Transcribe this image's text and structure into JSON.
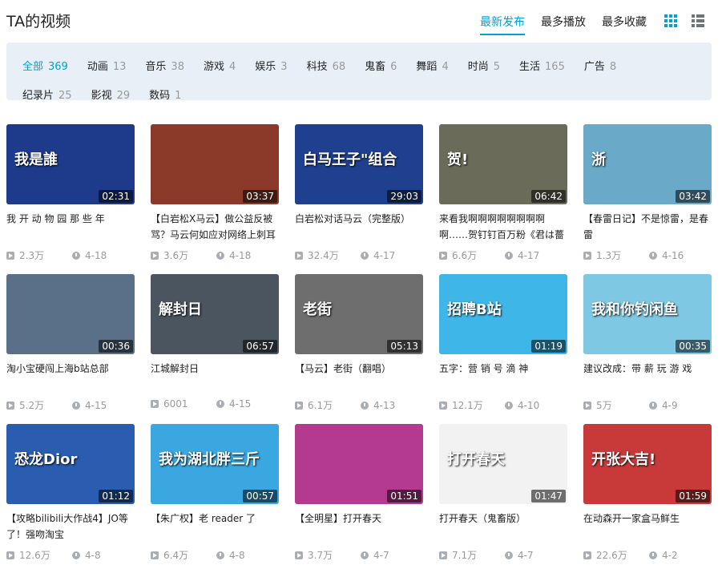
{
  "header": {
    "title": "TA的视频",
    "sort_tabs": [
      "最新发布",
      "最多播放",
      "最多收藏"
    ],
    "active_sort": 0,
    "accent_color": "#00a1d6",
    "grid_view_icon": "grid-icon",
    "list_view_icon": "list-icon"
  },
  "categories": [
    {
      "label": "全部",
      "count": "369"
    },
    {
      "label": "动画",
      "count": "13"
    },
    {
      "label": "音乐",
      "count": "38"
    },
    {
      "label": "游戏",
      "count": "4"
    },
    {
      "label": "娱乐",
      "count": "3"
    },
    {
      "label": "科技",
      "count": "68"
    },
    {
      "label": "鬼畜",
      "count": "6"
    },
    {
      "label": "舞蹈",
      "count": "4"
    },
    {
      "label": "时尚",
      "count": "5"
    },
    {
      "label": "生活",
      "count": "165"
    },
    {
      "label": "广告",
      "count": "8"
    },
    {
      "label": "纪录片",
      "count": "25"
    },
    {
      "label": "影视",
      "count": "29"
    },
    {
      "label": "数码",
      "count": "1"
    }
  ],
  "videos": [
    {
      "title": "我 开 动 物 园 那 些 年",
      "duration": "02:31",
      "views": "2.3万",
      "date": "4-18",
      "thumb_text": "我是誰",
      "thumb_bg": "#1e3a8a"
    },
    {
      "title": "【白岩松X马云】做公益反被骂？马云何如应对网络上刺耳",
      "duration": "03:37",
      "views": "3.6万",
      "date": "4-18",
      "thumb_text": "",
      "thumb_bg": "#8b3a2a"
    },
    {
      "title": "白岩松对话马云（完整版）",
      "duration": "29:03",
      "views": "32.4万",
      "date": "4-17",
      "thumb_text": "白马王子\"组合",
      "thumb_bg": "#1f3f8f"
    },
    {
      "title": "来看我啊啊啊啊啊啊啊啊啊……贺钉钉百万粉《君は薔",
      "duration": "06:42",
      "views": "6.6万",
      "date": "4-17",
      "thumb_text": "贺!",
      "thumb_bg": "#6b6b5a"
    },
    {
      "title": "【春雷日记】不是惊雷，是春雷",
      "duration": "03:42",
      "views": "1.3万",
      "date": "4-16",
      "thumb_text": "浙",
      "thumb_bg": "#6aa9c7"
    },
    {
      "title": "淘小宝硬闯上海b站总部",
      "duration": "00:36",
      "views": "5.2万",
      "date": "4-15",
      "thumb_text": "",
      "thumb_bg": "#5a6f88"
    },
    {
      "title": "江城解封日",
      "duration": "06:57",
      "views": "6001",
      "date": "4-15",
      "thumb_text": "解封日",
      "thumb_bg": "#4a5560"
    },
    {
      "title": "【马云】老街（翻唱）",
      "duration": "05:13",
      "views": "6.1万",
      "date": "4-13",
      "thumb_text": "老街",
      "thumb_bg": "#6e6e6e"
    },
    {
      "title": "五字：营 销 号 滴 神",
      "duration": "01:19",
      "views": "12.1万",
      "date": "4-10",
      "thumb_text": "招聘B站",
      "thumb_bg": "#3fb6e8"
    },
    {
      "title": "建议改成：带 薪 玩 游 戏",
      "duration": "00:35",
      "views": "5万",
      "date": "4-9",
      "thumb_text": "我和你钓闲鱼",
      "thumb_bg": "#7ec8e3"
    },
    {
      "title": "【攻略bilibili大作战4】JO等了！强吻淘宝",
      "duration": "01:12",
      "views": "12.6万",
      "date": "4-8",
      "thumb_text": "恐龙Dior",
      "thumb_bg": "#2a5db0"
    },
    {
      "title": "【朱广权】老 reader 了",
      "duration": "00:57",
      "views": "6.4万",
      "date": "4-8",
      "thumb_text": "我为湖北胖三斤",
      "thumb_bg": "#3aa7e0"
    },
    {
      "title": "【全明星】打开春天",
      "duration": "01:51",
      "views": "3.7万",
      "date": "4-7",
      "thumb_text": "",
      "thumb_bg": "#b43a8f"
    },
    {
      "title": "打开春天（鬼畜版）",
      "duration": "01:47",
      "views": "7.1万",
      "date": "4-7",
      "thumb_text": "打开春天",
      "thumb_bg": "#f2f2f2"
    },
    {
      "title": "在动森开一家盒马鲜生",
      "duration": "01:59",
      "views": "22.6万",
      "date": "4-2",
      "thumb_text": "开张大吉!",
      "thumb_bg": "#c83a3a"
    }
  ]
}
